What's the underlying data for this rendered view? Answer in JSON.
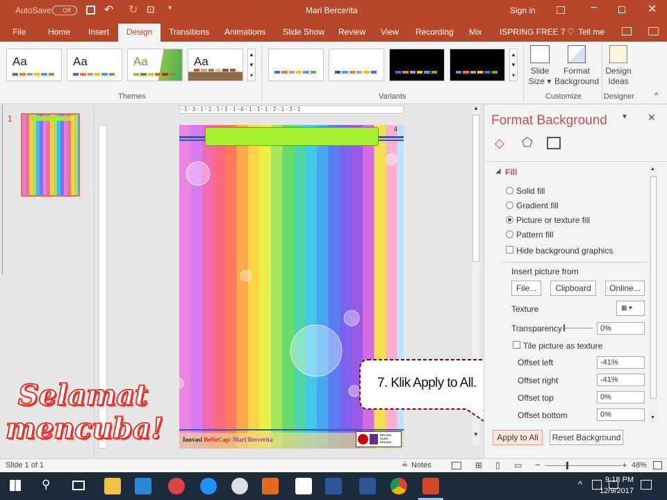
{
  "titlebar": {
    "autosave": "AutoSave",
    "autosave_state": "Off",
    "document_title": "Mari Bercerita",
    "sign_in": "Sign in"
  },
  "tabs": [
    "File",
    "Home",
    "Insert",
    "Design",
    "Transitions",
    "Animations",
    "Slide Show",
    "Review",
    "View",
    "Recording",
    "Mix",
    "ISPRING FREE 7"
  ],
  "tell_me": "Tell me",
  "ribbon": {
    "themes_label": "Themes",
    "variants_label": "Variants",
    "customize_label": "Customize",
    "designer_label": "Designer",
    "theme_sample": "Aa",
    "slide_size_label_1": "Slide",
    "slide_size_label_2": "Size",
    "format_bg_label_1": "Format",
    "format_bg_label_2": "Background",
    "design_ideas_label_1": "Design",
    "design_ideas_label_2": "Ideas"
  },
  "thumbnail": {
    "slide_number": "1"
  },
  "slide": {
    "footer_text_1": "Inovasi",
    "footer_text_2": "BeNeCap:",
    "footer_text_3": "Mari Bercerita",
    "logo_text_1": "PROJEK",
    "logo_text_2": "GURU",
    "logo_text_3": "INOVASI",
    "slide_page_number": "4"
  },
  "overlay": {
    "callout_text": "7. Klik Apply to All.",
    "word_art_line_1": "Selamat",
    "word_art_line_2": "mencuba!"
  },
  "pane": {
    "title": "Format Background",
    "section": "Fill",
    "options": [
      "Solid fill",
      "Gradient fill",
      "Picture or texture fill",
      "Pattern fill"
    ],
    "selected_option": "Picture or texture fill",
    "hide_bg": "Hide background graphics",
    "insert_from": "Insert picture from",
    "file_btn": "File...",
    "clipboard_btn": "Clipboard",
    "online_btn": "Online...",
    "texture": "Texture",
    "transparency": "Transparency",
    "transparency_value": "0%",
    "tile": "Tile picture as texture",
    "offset_left": "Offset left",
    "offset_left_value": "-41%",
    "offset_right": "Offset right",
    "offset_right_value": "-41%",
    "offset_top": "Offset top",
    "offset_top_value": "0%",
    "offset_bottom": "Offset bottom",
    "offset_bottom_value": "0%",
    "apply_all": "Apply to All",
    "reset_bg": "Reset Background"
  },
  "status": {
    "slide_info": "Slide 1 of 1",
    "notes": "Notes",
    "zoom": "48%"
  },
  "taskbar": {
    "time": "9:18 PM",
    "date": "12/9/2017"
  },
  "colors": {
    "accent": "#b7472a",
    "pane_title": "#c0504d",
    "callout_border": "#8b0000"
  }
}
